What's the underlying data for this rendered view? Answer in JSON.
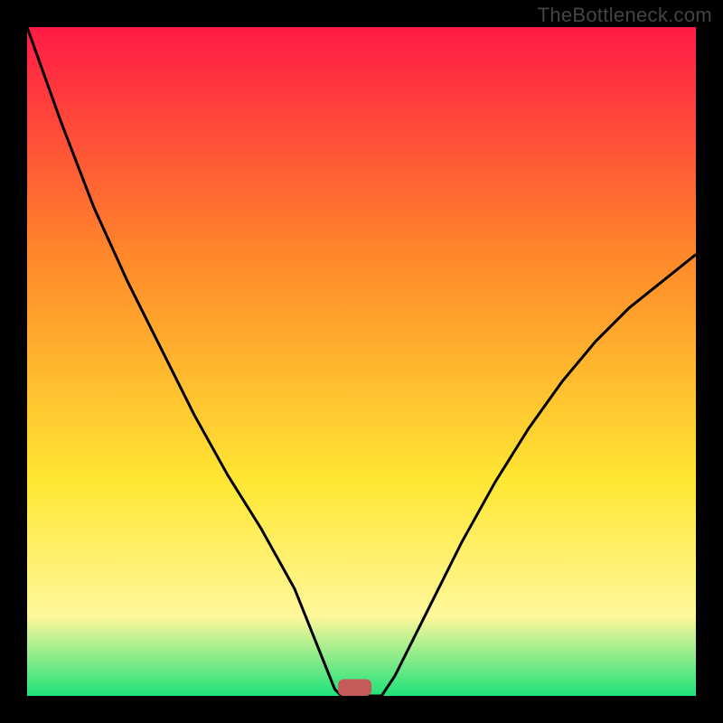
{
  "watermark": "TheBottleneck.com",
  "colors": {
    "bg": "#000000",
    "grad_top": "#ff1a45",
    "grad_mid1": "#ff8a2a",
    "grad_mid2": "#ffe733",
    "grad_mid3": "#fff79a",
    "grad_bot": "#1fe27a",
    "curve": "#000000",
    "marker": "#c45a5a"
  },
  "chart_data": {
    "type": "line",
    "title": "",
    "xlabel": "",
    "ylabel": "",
    "xlim": [
      0,
      100
    ],
    "ylim": [
      0,
      100
    ],
    "series": [
      {
        "name": "curve",
        "x": [
          0,
          5,
          10,
          15,
          20,
          25,
          30,
          35,
          40,
          42,
          44,
          46,
          47,
          50,
          53,
          55,
          60,
          65,
          70,
          75,
          80,
          85,
          90,
          95,
          100
        ],
        "y": [
          100,
          86,
          73,
          62,
          52,
          42,
          33,
          25,
          16,
          11,
          6,
          1,
          0,
          0,
          0,
          3,
          13,
          23,
          32,
          40,
          47,
          53,
          58,
          62,
          66
        ]
      }
    ],
    "marker": {
      "x": 49,
      "y": 0,
      "w": 5,
      "h": 2.5
    },
    "grid": false,
    "legend": false
  }
}
